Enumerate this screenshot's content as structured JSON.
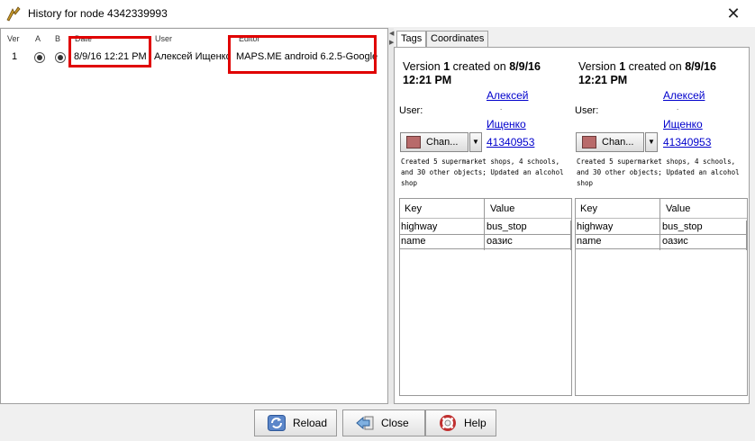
{
  "window": {
    "title": "History for node 4342339993",
    "close_glyph": "✕"
  },
  "history_table": {
    "headers": [
      "Ver",
      "A",
      "B",
      "Date",
      "User",
      "Editor"
    ],
    "rows": [
      {
        "ver": "1",
        "a_selected": true,
        "b_selected": true,
        "date": "8/9/16 12:21 PM",
        "user": "Алексей Ищенко",
        "editor": "MAPS.ME android 6.2.5-Google"
      }
    ]
  },
  "tabs": [
    "Tags",
    "Coordinates"
  ],
  "versions": [
    {
      "prefix": "Version",
      "number": "1",
      "created": "created on",
      "date": "8/9/16",
      "time": "12:21 PM",
      "user_label": "User:",
      "user_first": "Алексей",
      "user_last": "Ищенко",
      "user_id": "41340953",
      "changeset_button": "Chan...",
      "comment": "Created 5 supermarket shops, 4 schools, and 30 other objects; Updated an alcohol shop",
      "tag_headers": [
        "Key",
        "Value"
      ],
      "tags": [
        {
          "key": "highway",
          "value": "bus_stop"
        },
        {
          "key": "name",
          "value": "оазис"
        }
      ]
    },
    {
      "prefix": "Version",
      "number": "1",
      "created": "created on",
      "date": "8/9/16",
      "time": "12:21 PM",
      "user_label": "User:",
      "user_first": "Алексей",
      "user_last": "Ищенко",
      "user_id": "41340953",
      "changeset_button": "Chan...",
      "comment": "Created 5 supermarket shops, 4 schools, and 30 other objects; Updated an alcohol shop",
      "tag_headers": [
        "Key",
        "Value"
      ],
      "tags": [
        {
          "key": "highway",
          "value": "bus_stop"
        },
        {
          "key": "name",
          "value": "оазис"
        }
      ]
    }
  ],
  "buttons": {
    "reload": "Reload",
    "close": "Close",
    "help": "Help"
  },
  "icons": [
    "app-icon",
    "close-icon",
    "changeset-icon",
    "dropdown-arrow-icon",
    "reload-icon",
    "close-arrow-icon",
    "help-lifebuoy-icon"
  ],
  "colors": {
    "highlight_box": "#e00000",
    "link": "#0000cc"
  }
}
